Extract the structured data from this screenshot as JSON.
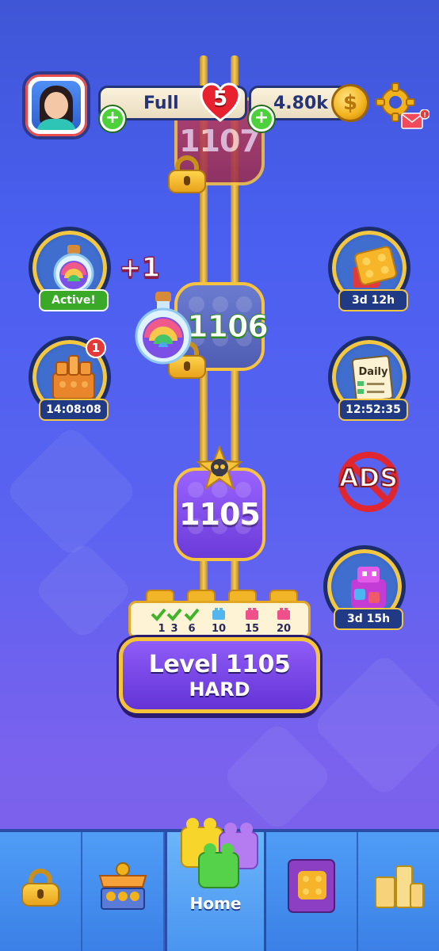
{
  "header": {
    "lives_status": "Full",
    "lives_count": "5",
    "coins": "4.80k",
    "coin_symbol": "$"
  },
  "levels": {
    "locked_next": "1107",
    "next": "1106",
    "current": "1105"
  },
  "boosters": {
    "potion_status": "Active!",
    "potion_bonus": "+1",
    "castle_timer": "14:08:08",
    "castle_badge": "1",
    "brick_timer": "3d 12h",
    "daily_label": "Daily",
    "daily_timer": "12:52:35",
    "no_ads_label": "ADS",
    "robot_timer": "3d 15h"
  },
  "progress": {
    "milestones": [
      "1",
      "3",
      "6",
      "10",
      "15",
      "20"
    ],
    "completed": 3
  },
  "level_card": {
    "title": "Level 1105",
    "difficulty": "HARD"
  },
  "nav": {
    "home_label": "Home"
  },
  "colors": {
    "background_top": "#3f56d6",
    "background_bottom": "#7d5fe6",
    "accent_gold": "#f6c43b",
    "current_level": "#8f5cf7",
    "nav_bar": "#4f9df7"
  }
}
